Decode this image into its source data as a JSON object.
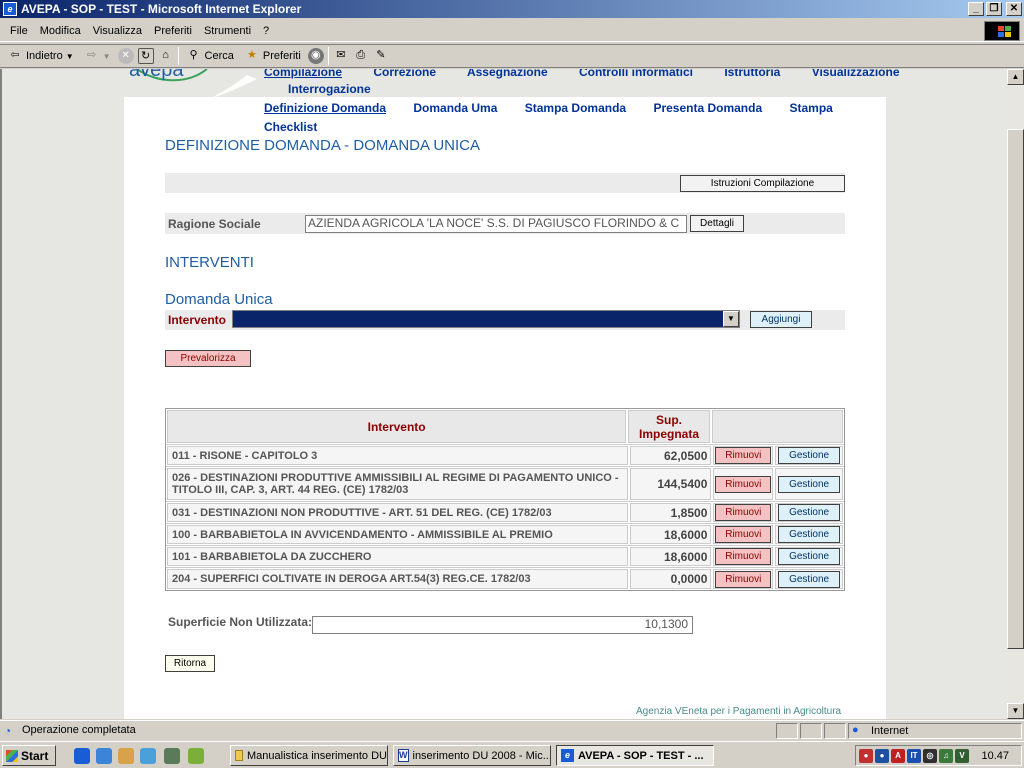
{
  "window": {
    "title": "AVEPA - SOP - TEST - Microsoft Internet Explorer",
    "minimize": "_",
    "maximize": "❒",
    "close": "✕"
  },
  "menubar": [
    "File",
    "Modifica",
    "Visualizza",
    "Preferiti",
    "Strumenti",
    "?"
  ],
  "toolbar": {
    "back": "Indietro",
    "search": "Cerca",
    "favorites": "Preferiti"
  },
  "nav": {
    "top": [
      "Compilazione",
      "Correzione",
      "Assegnazione",
      "Controlli informatici",
      "Istruttoria",
      "Visualizzazione"
    ],
    "top_second_line": "Interrogazione",
    "sub": [
      "Definizione Domanda",
      "Domanda Uma",
      "Stampa Domanda",
      "Presenta Domanda",
      "Stampa"
    ],
    "sub_second_line": "Checklist"
  },
  "page": {
    "title": "DEFINIZIONE DOMANDA  - DOMANDA UNICA",
    "istruzioni_button": "Istruzioni Compilazione",
    "ragione_sociale_label": "Ragione Sociale",
    "ragione_sociale_value": "AZIENDA AGRICOLA 'LA NOCE' S.S. DI PAGIUSCO FLORINDO & C",
    "dettagli_button": "Dettagli",
    "interventi_heading": "INTERVENTI",
    "domanda_unica_heading": "Domanda Unica",
    "intervento_label": "Intervento",
    "intervento_selected": "",
    "aggiungi_button": "Aggiungi",
    "prevalorizza_button": "Prevalorizza",
    "superficie_label": "Superficie Non Utilizzata:",
    "superficie_value": "10,1300",
    "ritorna_button": "Ritorna"
  },
  "table": {
    "headers": [
      "Intervento",
      "Sup. Impegnata"
    ],
    "remove_label": "Rimuovi",
    "manage_label": "Gestione",
    "rows": [
      {
        "intervento": "011 - RISONE - CAPITOLO 3",
        "sup": "62,0500"
      },
      {
        "intervento": "026 - DESTINAZIONI PRODUTTIVE AMMISSIBILI AL REGIME DI PAGAMENTO UNICO - TITOLO III, CAP. 3, ART. 44 REG. (CE) 1782/03",
        "sup": "144,5400"
      },
      {
        "intervento": "031 - DESTINAZIONI NON PRODUTTIVE - ART. 51 DEL REG. (CE) 1782/03",
        "sup": "1,8500"
      },
      {
        "intervento": "100 - BARBABIETOLA IN AVVICENDAMENTO - AMMISSIBILE AL PREMIO",
        "sup": "18,6000"
      },
      {
        "intervento": "101 - BARBABIETOLA DA ZUCCHERO",
        "sup": "18,6000"
      },
      {
        "intervento": "204 - SUPERFICI COLTIVATE IN DEROGA ART.54(3) REG.CE. 1782/03",
        "sup": "0,0000"
      }
    ]
  },
  "footer": "Agenzia VEneta per i Pagamenti in Agricoltura",
  "status": {
    "text": "Operazione completata",
    "zone": "Internet"
  },
  "taskbar": {
    "start": "Start",
    "tasks": [
      "Manualistica inserimento DU",
      "inserimento DU 2008 - Mic...",
      "AVEPA - SOP - TEST - ..."
    ],
    "clock": "10.47"
  },
  "colors": {
    "nav_link": "#003399",
    "heading": "#1f5ea5",
    "danger": "#8b0000",
    "remove_bg": "#f4c2c2",
    "manage_bg": "#dff1f8"
  }
}
